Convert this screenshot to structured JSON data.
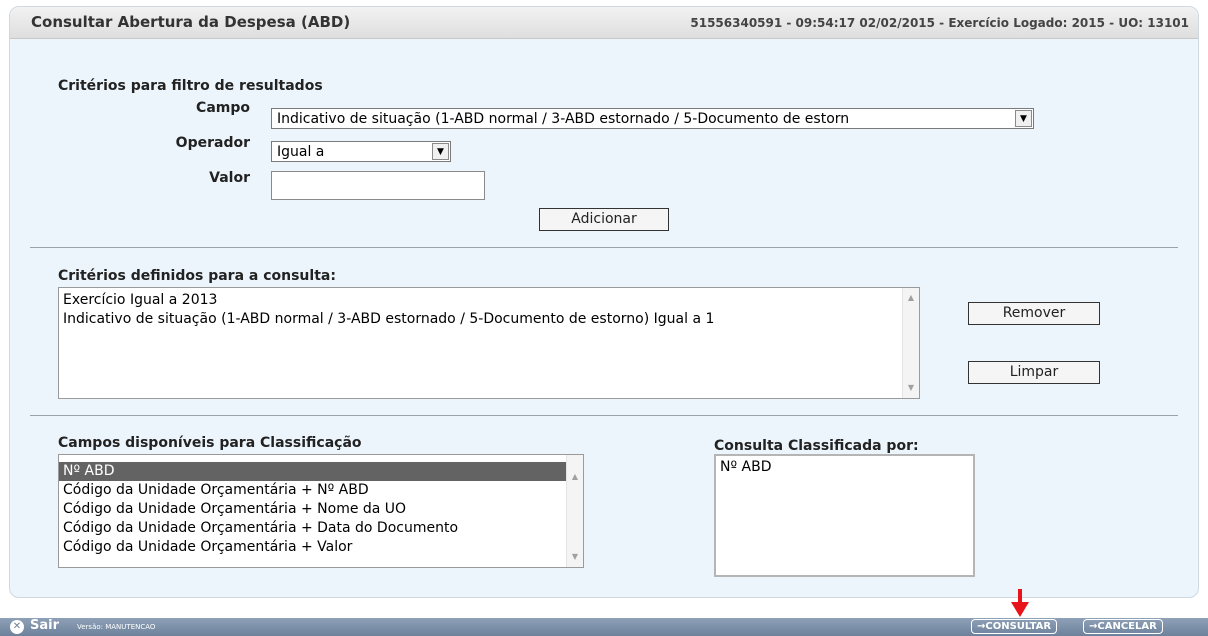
{
  "header": {
    "title": "Consultar Abertura da Despesa (ABD)",
    "info": "51556340591 - 09:54:17 02/02/2015 - Exercício Logado: 2015 - UO: 13101"
  },
  "filter": {
    "section_title": "Critérios para filtro de resultados",
    "campo_label": "Campo",
    "campo_value": "Indicativo de situação (1-ABD normal / 3-ABD estornado / 5-Documento de estorn",
    "operador_label": "Operador",
    "operador_value": "Igual a",
    "valor_label": "Valor",
    "valor_value": "",
    "add_label": "Adicionar"
  },
  "criteria": {
    "section_title": "Critérios definidos para a consulta:",
    "items": [
      "Exercício Igual a 2013",
      "Indicativo de situação (1-ABD normal / 3-ABD estornado / 5-Documento de estorno) Igual a 1"
    ],
    "remove_label": "Remover",
    "clear_label": "Limpar"
  },
  "classification": {
    "available_title": "Campos disponíveis para Classificação",
    "available_items": [
      "Nº ABD",
      "Código da Unidade Orçamentária + Nº ABD",
      "Código da Unidade Orçamentária + Nome da UO",
      "Código da Unidade Orçamentária + Data do Documento",
      "Código da Unidade Orçamentária + Valor"
    ],
    "selected_index": 0,
    "sorted_title": "Consulta Classificada por:",
    "sorted_items": [
      "Nº ABD"
    ]
  },
  "footer": {
    "sair_label": "Sair",
    "version_label": "Versão: MANUTENCAO",
    "consultar_label": "→CONSULTAR",
    "cancelar_label": "→CANCELAR"
  },
  "colors": {
    "panel_bg": "#edf5fc",
    "footer_bg": "#6d819b",
    "selected_item_bg": "#636363",
    "annotation_arrow": "#e8141c"
  }
}
